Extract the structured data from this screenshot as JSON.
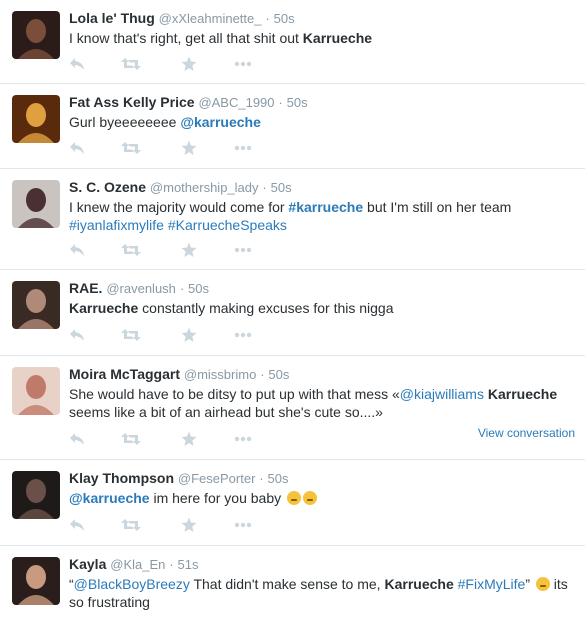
{
  "tweets": [
    {
      "fullname": "Lola le' Thug",
      "username": "@xXleahminette_",
      "sep": "·",
      "time": "50s",
      "text": [
        {
          "t": "I know that's right, get all that shit out ",
          "k": "plain"
        },
        {
          "t": "Karrueche",
          "k": "kw"
        }
      ],
      "avatar_colors": [
        "#2b1c1a",
        "#7a4e3a"
      ]
    },
    {
      "fullname": "Fat Ass Kelly Price",
      "username": "@ABC_1990",
      "sep": "·",
      "time": "50s",
      "text": [
        {
          "t": "Gurl byeeeeeeee ",
          "k": "plain"
        },
        {
          "t": "@karrueche",
          "k": "linkb"
        }
      ],
      "avatar_colors": [
        "#5a2a0c",
        "#e0a040"
      ]
    },
    {
      "fullname": "S. C. Ozene",
      "username": "@mothership_lady",
      "sep": "·",
      "time": "50s",
      "text": [
        {
          "t": "I knew the majority would come for ",
          "k": "plain"
        },
        {
          "t": "#karrueche",
          "k": "linkb"
        },
        {
          "t": " but I'm still on her team ",
          "k": "plain"
        },
        {
          "t": "#iyanlafixmylife",
          "k": "link"
        },
        {
          "t": " ",
          "k": "plain"
        },
        {
          "t": "#KarruecheSpeaks",
          "k": "link"
        }
      ],
      "avatar_colors": [
        "#c9c4c0",
        "#4a3032"
      ]
    },
    {
      "fullname": "RAE.",
      "username": "@ravenlush",
      "sep": "·",
      "time": "50s",
      "text": [
        {
          "t": "Karrueche",
          "k": "kw"
        },
        {
          "t": " constantly making excuses for this nigga",
          "k": "plain"
        }
      ],
      "avatar_colors": [
        "#3a2a24",
        "#b08a78"
      ]
    },
    {
      "fullname": "Moira McTaggart",
      "username": "@missbrimo",
      "sep": "·",
      "time": "50s",
      "text": [
        {
          "t": "She would have to be ditsy to put up with that mess «",
          "k": "plain"
        },
        {
          "t": "@kiajwilliams",
          "k": "link"
        },
        {
          "t": " ",
          "k": "plain"
        },
        {
          "t": "Karrueche",
          "k": "kw"
        },
        {
          "t": " seems like a bit of an airhead but she's cute so....»",
          "k": "plain"
        }
      ],
      "view_conversation": "View conversation",
      "avatar_colors": [
        "#e8d2c8",
        "#c07a6a"
      ]
    },
    {
      "fullname": "Klay Thompson",
      "username": "@FesePorter",
      "sep": "·",
      "time": "50s",
      "text": [
        {
          "t": "@karrueche",
          "k": "linkb"
        },
        {
          "t": " im here for you baby ",
          "k": "plain"
        },
        {
          "t": "kiss-emoji",
          "k": "emoji"
        },
        {
          "t": "kiss-emoji",
          "k": "emoji"
        }
      ],
      "avatar_colors": [
        "#1e1a1a",
        "#6a5048"
      ]
    },
    {
      "fullname": "Kayla",
      "username": "@Kla_En",
      "sep": "·",
      "time": "51s",
      "text": [
        {
          "t": "“",
          "k": "plain"
        },
        {
          "t": "@BlackBoyBreezy",
          "k": "link"
        },
        {
          "t": " That didn't make sense to me, ",
          "k": "plain"
        },
        {
          "t": "Karrueche",
          "k": "kw"
        },
        {
          "t": " ",
          "k": "plain"
        },
        {
          "t": "#FixMyLife",
          "k": "link"
        },
        {
          "t": "” ",
          "k": "plain"
        },
        {
          "t": "tears-of-joy-emoji",
          "k": "emoji"
        },
        {
          "t": " its so frustrating",
          "k": "plain"
        }
      ],
      "avatar_colors": [
        "#2a1e1c",
        "#c89a80"
      ]
    }
  ],
  "icons": {
    "reply": "reply-icon",
    "retweet": "retweet-icon",
    "favorite": "favorite-icon",
    "more": "more-icon"
  },
  "colors": {
    "action_icon": "#ccd6dd",
    "link": "#2b7bb9",
    "meta": "#8899a6",
    "divider": "#e1e8ed"
  }
}
